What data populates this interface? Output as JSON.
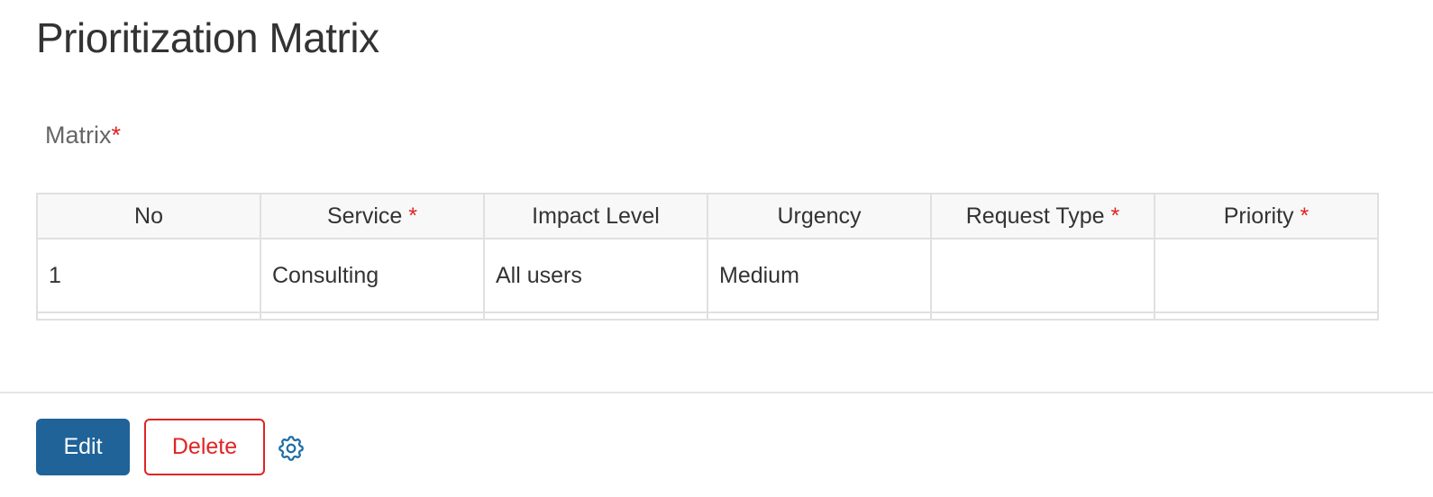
{
  "page": {
    "title": "Prioritization Matrix"
  },
  "matrix_field": {
    "label": "Matrix",
    "required_mark": "*"
  },
  "table": {
    "columns": [
      {
        "label": "No",
        "required": false
      },
      {
        "label": "Service",
        "required": true
      },
      {
        "label": "Impact Level",
        "required": false
      },
      {
        "label": "Urgency",
        "required": false
      },
      {
        "label": "Request Type",
        "required": true
      },
      {
        "label": "Priority",
        "required": true
      }
    ],
    "required_mark": "*",
    "rows": [
      {
        "no": "1",
        "service": "Consulting",
        "impact_level": "All users",
        "urgency": "Medium",
        "request_type": "",
        "priority": ""
      }
    ]
  },
  "actions": {
    "edit_label": "Edit",
    "delete_label": "Delete",
    "settings_icon": "gear-icon"
  },
  "colors": {
    "primary": "#1f6399",
    "link": "#1f6fa8",
    "danger": "#e02424",
    "header_bg": "#f8f8f8",
    "border": "#e0e0e0"
  }
}
